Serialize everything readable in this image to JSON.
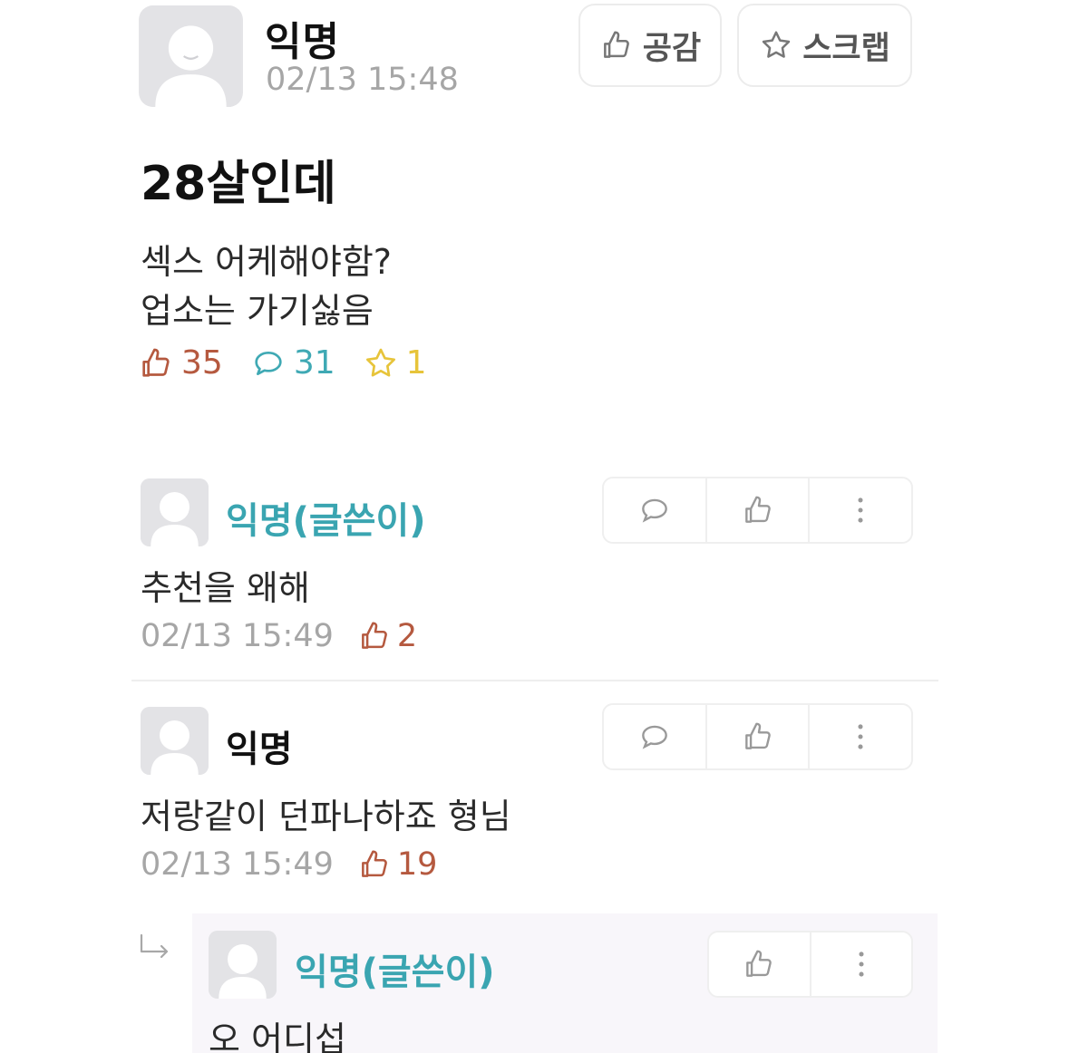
{
  "post": {
    "author": "익명",
    "time": "02/13 15:48",
    "like_button": "공감",
    "scrap_button": "스크랩",
    "title": "28살인데",
    "body_lines": [
      "섹스 어케해야함?",
      "업소는 가기싫음"
    ],
    "stats": {
      "likes": "35",
      "comments": "31",
      "scraps": "1"
    }
  },
  "comments": [
    {
      "author": "익명(글쓴이)",
      "text": "추천을 왜해",
      "time": "02/13 15:49",
      "likes": "2"
    },
    {
      "author": "익명",
      "text": "저랑같이 던파나하죠 형님",
      "time": "02/13 15:49",
      "likes": "19"
    },
    {
      "author": "익명(글쓴이)",
      "text": "오 어디섭"
    }
  ],
  "colors": {
    "accent_op": "#3aa5b1",
    "like": "#b5593f",
    "comment": "#3fa9b4",
    "scrap": "#e7c43a",
    "muted": "#a6a6a6"
  },
  "icons": [
    "thumb-up-icon",
    "star-icon",
    "speech-bubble-icon",
    "more-vertical-icon",
    "reply-arrow-icon"
  ]
}
